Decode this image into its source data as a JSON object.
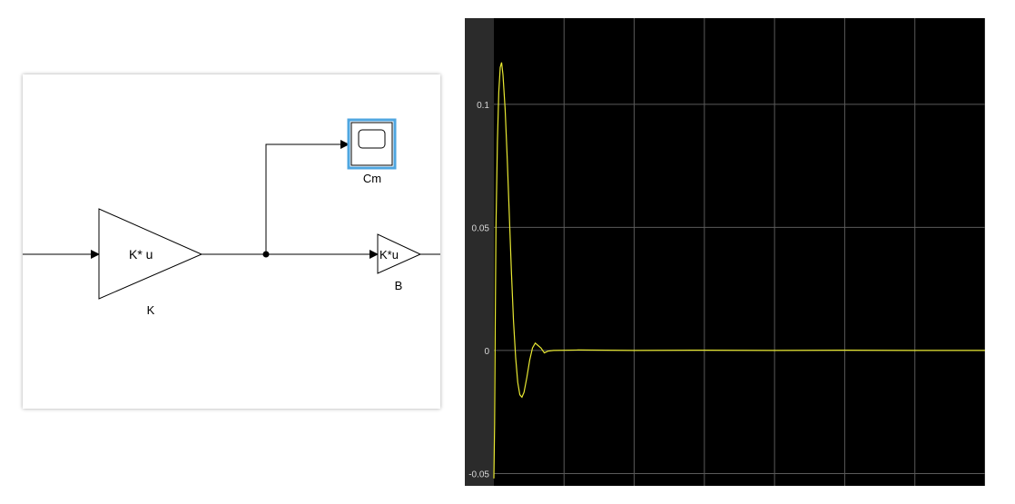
{
  "diagram": {
    "gain_k": {
      "display": "K* u",
      "name": "K"
    },
    "scope_cm": {
      "name": "Cm"
    },
    "gain_b": {
      "display": "K*u",
      "name": "B"
    }
  },
  "scope": {
    "background": "#000000",
    "frame": "#2b2b2b",
    "grid_color": "#5a5a5a",
    "line_color": "#e8e832"
  },
  "chart_data": {
    "type": "line",
    "title": "",
    "xlabel": "",
    "ylabel": "",
    "grid": true,
    "xlim": [
      0,
      7
    ],
    "ylim": [
      -0.055,
      0.135
    ],
    "y_tick_labels": [
      "0.1",
      "0.05",
      "0",
      "-0.05"
    ],
    "y_ticks": [
      0.1,
      0.05,
      0,
      -0.05
    ],
    "x_gridlines": 7,
    "series": [
      {
        "values_xy": [
          [
            0.0,
            -0.052
          ],
          [
            0.01,
            -0.03
          ],
          [
            0.02,
            0.01
          ],
          [
            0.03,
            0.05
          ],
          [
            0.05,
            0.085
          ],
          [
            0.07,
            0.105
          ],
          [
            0.09,
            0.115
          ],
          [
            0.11,
            0.117
          ],
          [
            0.13,
            0.112
          ],
          [
            0.16,
            0.098
          ],
          [
            0.19,
            0.078
          ],
          [
            0.22,
            0.055
          ],
          [
            0.25,
            0.032
          ],
          [
            0.28,
            0.012
          ],
          [
            0.31,
            -0.003
          ],
          [
            0.34,
            -0.013
          ],
          [
            0.37,
            -0.018
          ],
          [
            0.4,
            -0.019
          ],
          [
            0.43,
            -0.017
          ],
          [
            0.47,
            -0.011
          ],
          [
            0.51,
            -0.004
          ],
          [
            0.55,
            0.001
          ],
          [
            0.59,
            0.003
          ],
          [
            0.63,
            0.002
          ],
          [
            0.67,
            0.001
          ],
          [
            0.72,
            -0.001
          ],
          [
            0.77,
            -0.0003
          ],
          [
            0.85,
            0.0
          ],
          [
            1.2,
            0.0002
          ],
          [
            2.0,
            0.0
          ],
          [
            3.0,
            0.0001
          ],
          [
            4.0,
            0.0
          ],
          [
            5.0,
            0.0001
          ],
          [
            6.0,
            0.0
          ],
          [
            7.0,
            0.0
          ]
        ]
      }
    ]
  }
}
